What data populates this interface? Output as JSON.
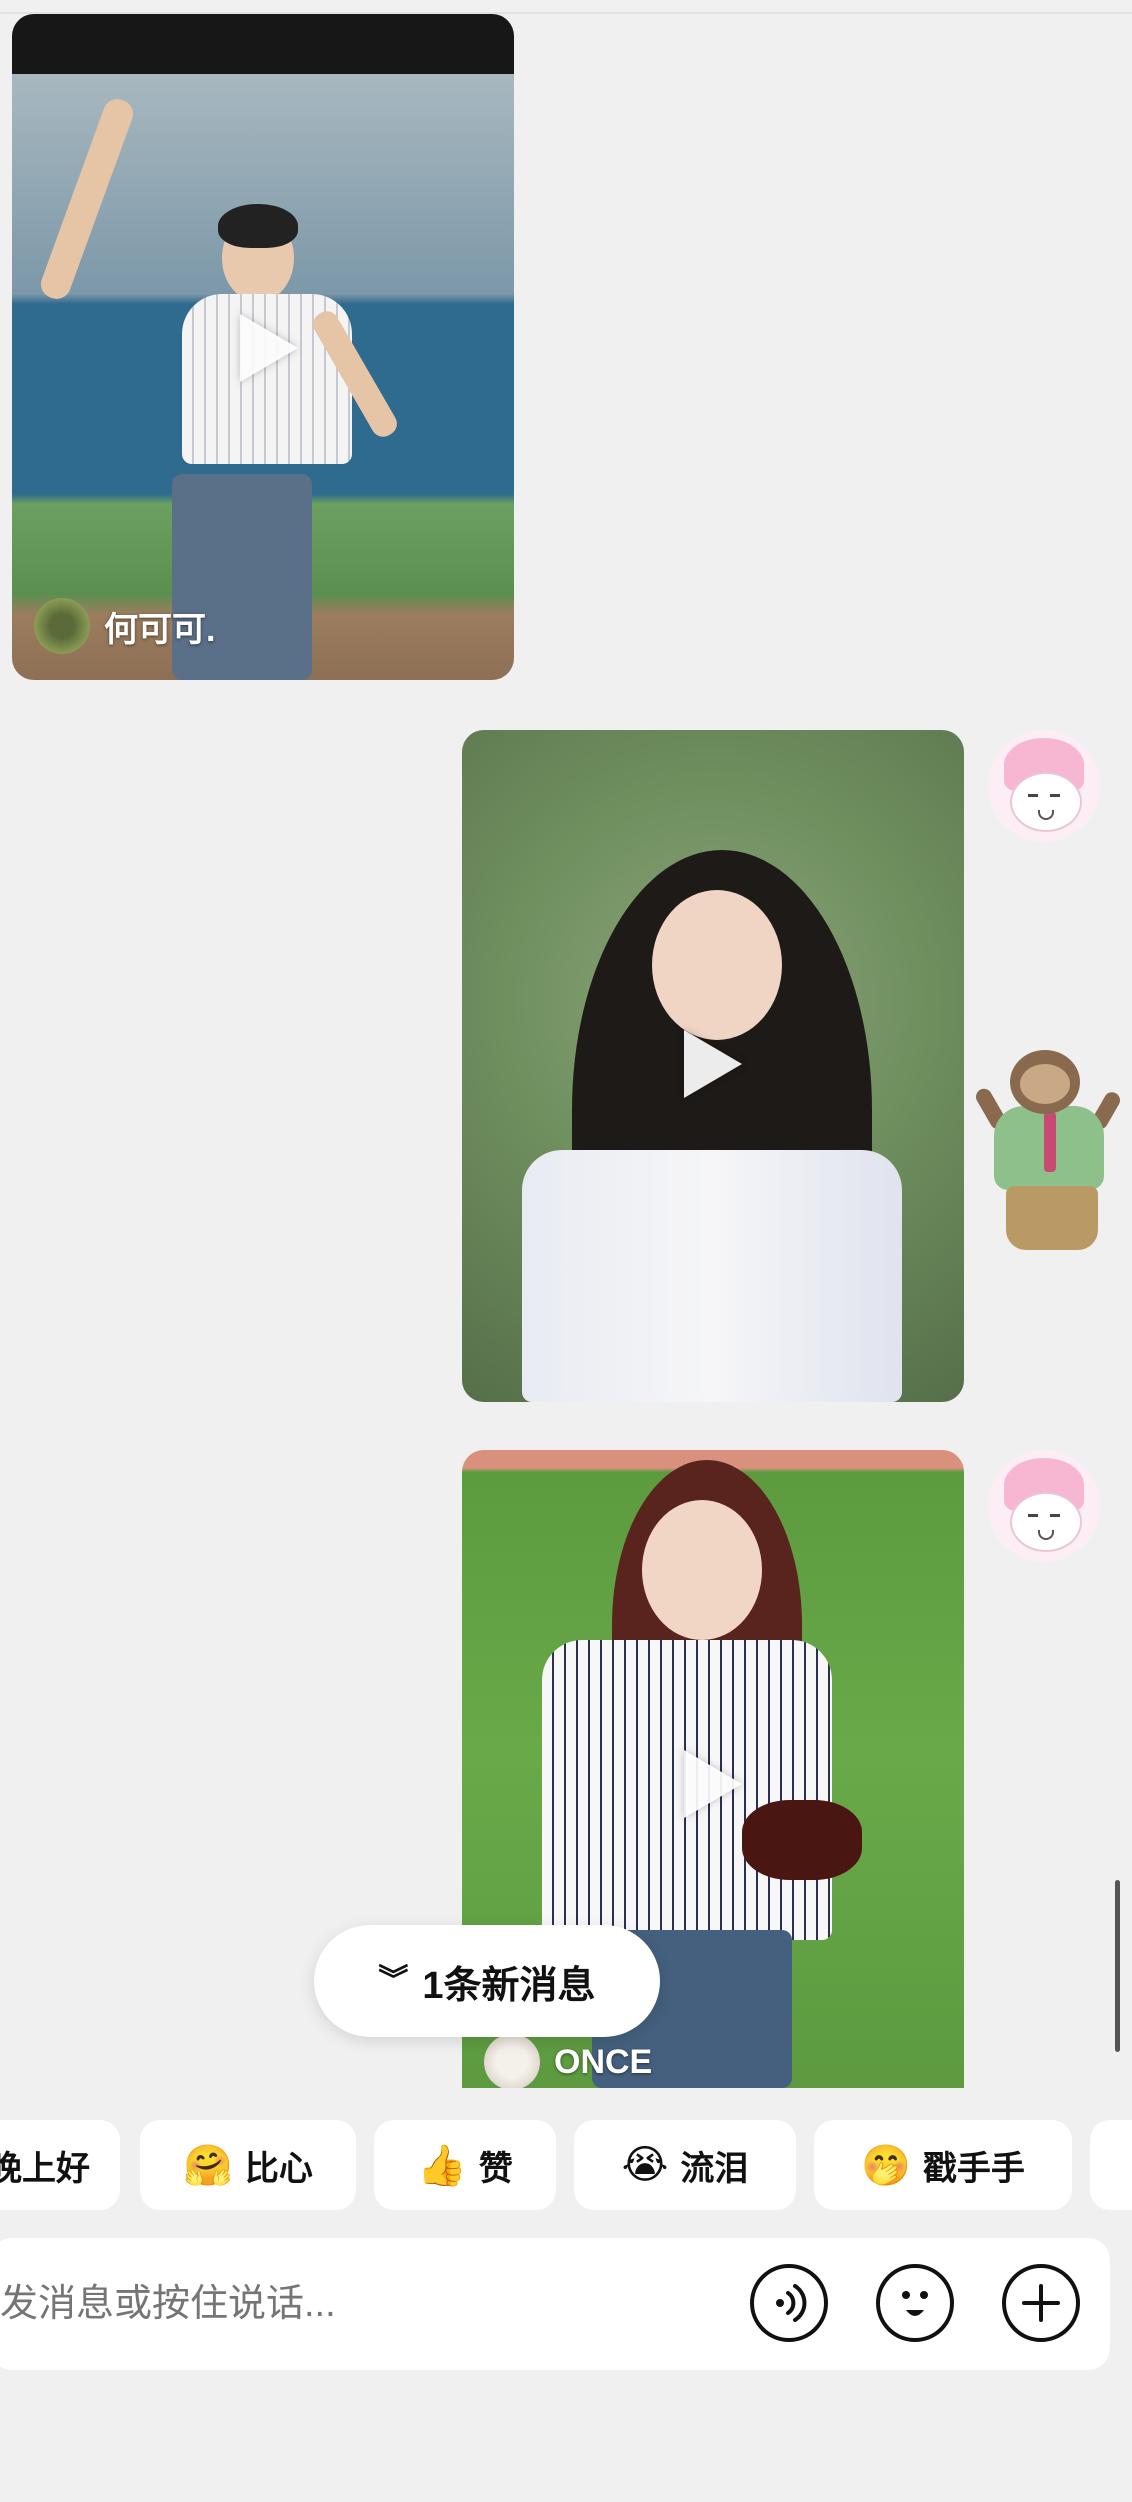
{
  "chat": {
    "messages": [
      {
        "type": "video",
        "side": "left",
        "author": "何可可.",
        "avatar_icon": "author-avatar-photo"
      },
      {
        "type": "video",
        "side": "right",
        "author": "",
        "avatar_icon": "melody-avatar-icon"
      },
      {
        "type": "sticker",
        "side": "right",
        "icon": "sloth-sticker-icon"
      },
      {
        "type": "video",
        "side": "right",
        "author": "ONCE",
        "avatar_icon": "melody-avatar-icon"
      }
    ]
  },
  "new_message_pill": {
    "icon": "double-chevron-down-icon",
    "label": "1条新消息"
  },
  "quick_reactions": [
    {
      "emoji": "",
      "label": "晚上好"
    },
    {
      "emoji": "🤗",
      "label": "比心"
    },
    {
      "emoji": "👍",
      "label": "赞"
    },
    {
      "emoji": "😭",
      "label": "流泪"
    },
    {
      "emoji": "🤭",
      "label": "戳手手"
    },
    {
      "emoji": "",
      "label": ""
    }
  ],
  "composer": {
    "placeholder": "发消息或按住说话...",
    "buttons": [
      "voice-icon",
      "emoji-icon",
      "plus-icon"
    ]
  }
}
